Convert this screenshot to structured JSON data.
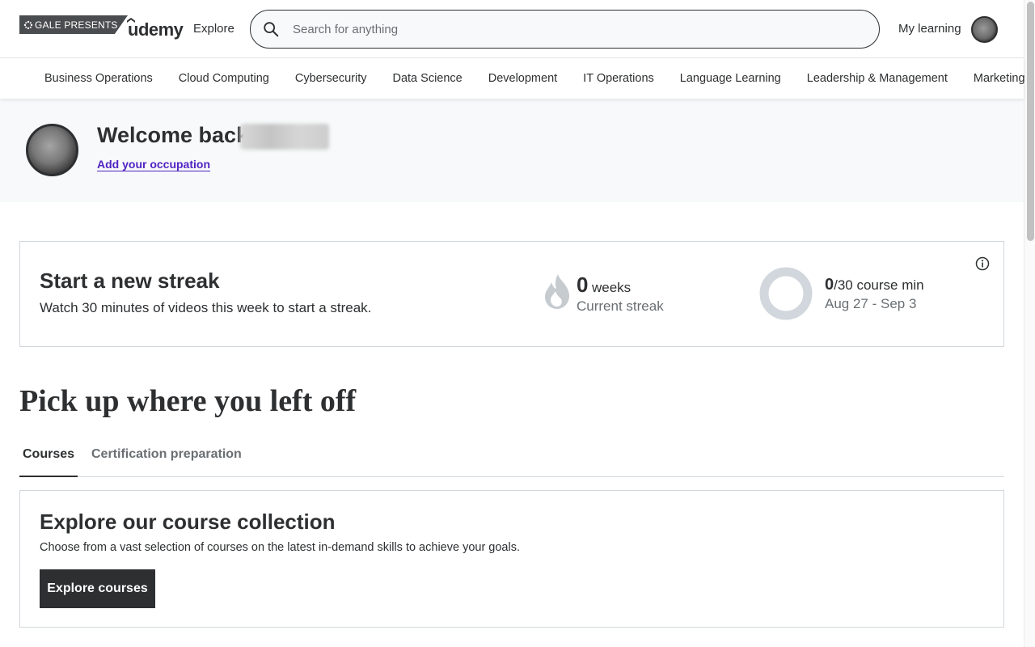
{
  "header": {
    "gale_badge": "GALE PRESENTS",
    "logo_text": "udemy",
    "explore_label": "Explore",
    "search_placeholder": "Search for anything",
    "my_learning_label": "My learning",
    "search_icon": "search-icon",
    "avatar_icon": "avatar"
  },
  "categories": [
    "Business Operations",
    "Cloud Computing",
    "Cybersecurity",
    "Data Science",
    "Development",
    "IT Operations",
    "Language Learning",
    "Leadership & Management",
    "Marketing"
  ],
  "welcome": {
    "greeting": "Welcome back,",
    "add_occupation": "Add your occupation"
  },
  "streak": {
    "title": "Start a new streak",
    "subtitle": "Watch 30 minutes of videos this week to start a streak.",
    "weeks_value": "0",
    "weeks_label": "weeks",
    "current_streak_label": "Current streak",
    "minutes_done": "0",
    "minutes_goal": "/30 course min",
    "date_range": "Aug 27 - Sep 3",
    "progress_fraction": 0,
    "flame_icon": "flame-icon",
    "info_icon": "info-icon"
  },
  "pickup": {
    "title": "Pick up where you left off",
    "tabs": [
      "Courses",
      "Certification preparation"
    ],
    "active_tab": "Courses"
  },
  "explore_card": {
    "title": "Explore our course collection",
    "subtitle": "Choose from a vast selection of courses on the latest in-demand skills to achieve your goals.",
    "button_label": "Explore courses"
  },
  "colors": {
    "text": "#2d2f31",
    "muted": "#6a6f73",
    "link": "#5022c3",
    "border": "#d1d7dc",
    "band_bg": "#f7f9fa"
  }
}
